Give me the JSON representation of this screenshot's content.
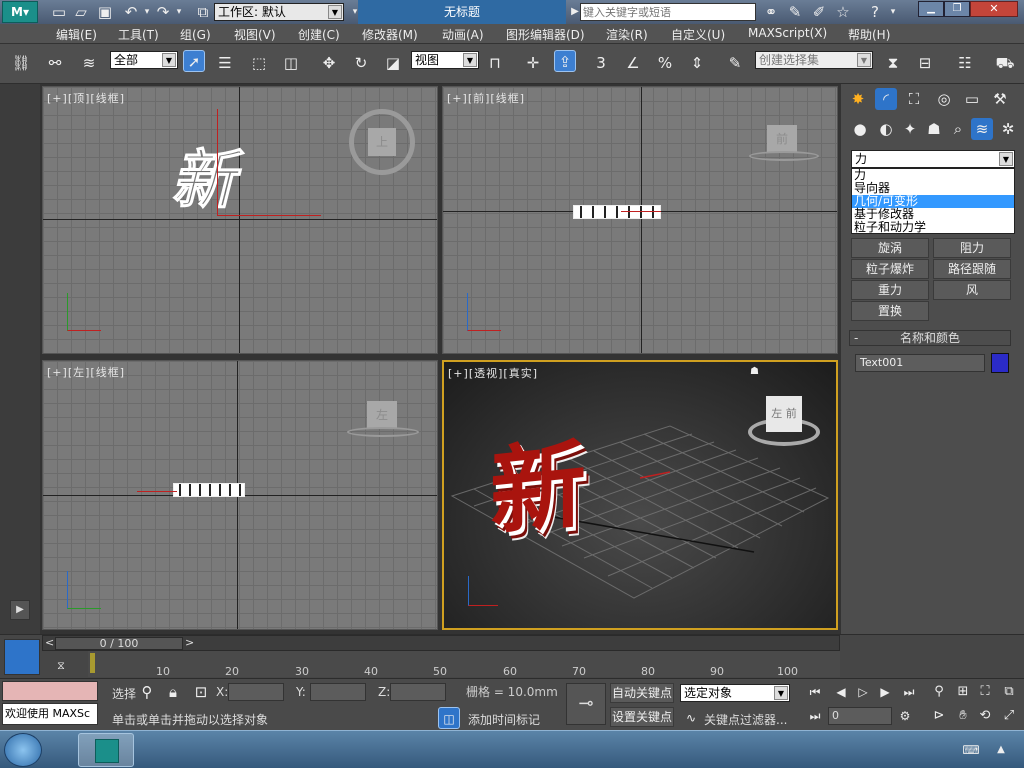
{
  "app": {
    "workspace": "工作区: 默认",
    "title": "无标题",
    "search_placeholder": "键入关键字或短语"
  },
  "menu": [
    "编辑(E)",
    "工具(T)",
    "组(G)",
    "视图(V)",
    "创建(C)",
    "修改器(M)",
    "动画(A)",
    "图形编辑器(D)",
    "渲染(R)",
    "自定义(U)",
    "MAXScript(X)",
    "帮助(H)"
  ],
  "toolbar": {
    "filter": "全部",
    "refcoord": "视图",
    "named_sel": "创建选择集",
    "snap_label": "3"
  },
  "viewports": {
    "top": [
      "[+]",
      "[顶]",
      "[线框]"
    ],
    "front": [
      "[+]",
      "[前]",
      "[线框]"
    ],
    "left": [
      "[+]",
      "[左]",
      "[线框]"
    ],
    "persp": [
      "[+]",
      "[透视]",
      "[真实]"
    ],
    "cube_top": "上",
    "cube_front": "前",
    "cube_left": "左",
    "cube_persp_a": "左",
    "cube_persp_b": "前",
    "text_glyph": "新"
  },
  "cmd": {
    "dropdown_value": "力",
    "options": [
      "力",
      "导向器",
      "几何/可变形",
      "基于修改器",
      "粒子和动力学"
    ],
    "selected_option": "几何/可变形",
    "buttons": [
      [
        "旋涡",
        "阻力"
      ],
      [
        "粒子爆炸",
        "路径跟随"
      ],
      [
        "重力",
        "风"
      ],
      [
        "置换",
        ""
      ]
    ],
    "rollout_title": "名称和颜色",
    "name_value": "Text001",
    "rollout_toggle": "-",
    "color": "#2b2bc8"
  },
  "timeline": {
    "frame": "0 / 100",
    "ticks": [
      "0",
      "10",
      "20",
      "30",
      "40",
      "50",
      "60",
      "70",
      "80",
      "90",
      "100"
    ]
  },
  "status": {
    "script_text": "欢迎使用 MAXSc",
    "selection_label": "选择",
    "x_label": "X:",
    "y_label": "Y:",
    "z_label": "Z:",
    "grid": "栅格 = 10.0mm",
    "autokey": "自动关键点",
    "setkey": "设置关键点",
    "keymode": "选定对象",
    "keyfilter": "关键点过滤器...",
    "prompt": "单击或单击并拖动以选择对象",
    "add_time_tag": "添加时间标记",
    "frame_field": "0"
  },
  "colors": {
    "accent": "#2e74c9",
    "axis_red": "#c02020",
    "selection_blue": "#3399ff"
  }
}
